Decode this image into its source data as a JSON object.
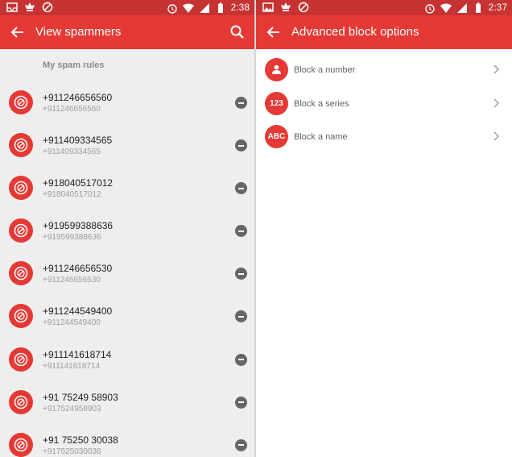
{
  "left_status": {
    "time": "2:38"
  },
  "right_status": {
    "time": "2:37"
  },
  "left_screen": {
    "title": "View spammers",
    "section_label": "My spam rules",
    "items": [
      {
        "number": "+911246656560",
        "sub": "+911246656560"
      },
      {
        "number": "+911409334565",
        "sub": "+911409334565"
      },
      {
        "number": "+918040517012",
        "sub": "+918040517012"
      },
      {
        "number": "+919599388636",
        "sub": "+919599388636"
      },
      {
        "number": "+911246656530",
        "sub": "+911246656530"
      },
      {
        "number": "+911244549400",
        "sub": "+911244549400"
      },
      {
        "number": "+911141618714",
        "sub": "+911141618714"
      },
      {
        "number": "+91 75249 58903",
        "sub": "+917524958903"
      },
      {
        "number": "+91 75250 30038",
        "sub": "+917525030038"
      }
    ]
  },
  "right_screen": {
    "title": "Advanced block options",
    "options": [
      {
        "icon": "person-icon",
        "badge": "",
        "label": "Block a number"
      },
      {
        "icon": "series-badge",
        "badge": "123",
        "label": "Block a series"
      },
      {
        "icon": "name-badge",
        "badge": "ABC",
        "label": "Block a name"
      }
    ]
  },
  "colors": {
    "primary": "#e53935",
    "status_bar": "#c73232",
    "list_background": "#eeeeee"
  }
}
